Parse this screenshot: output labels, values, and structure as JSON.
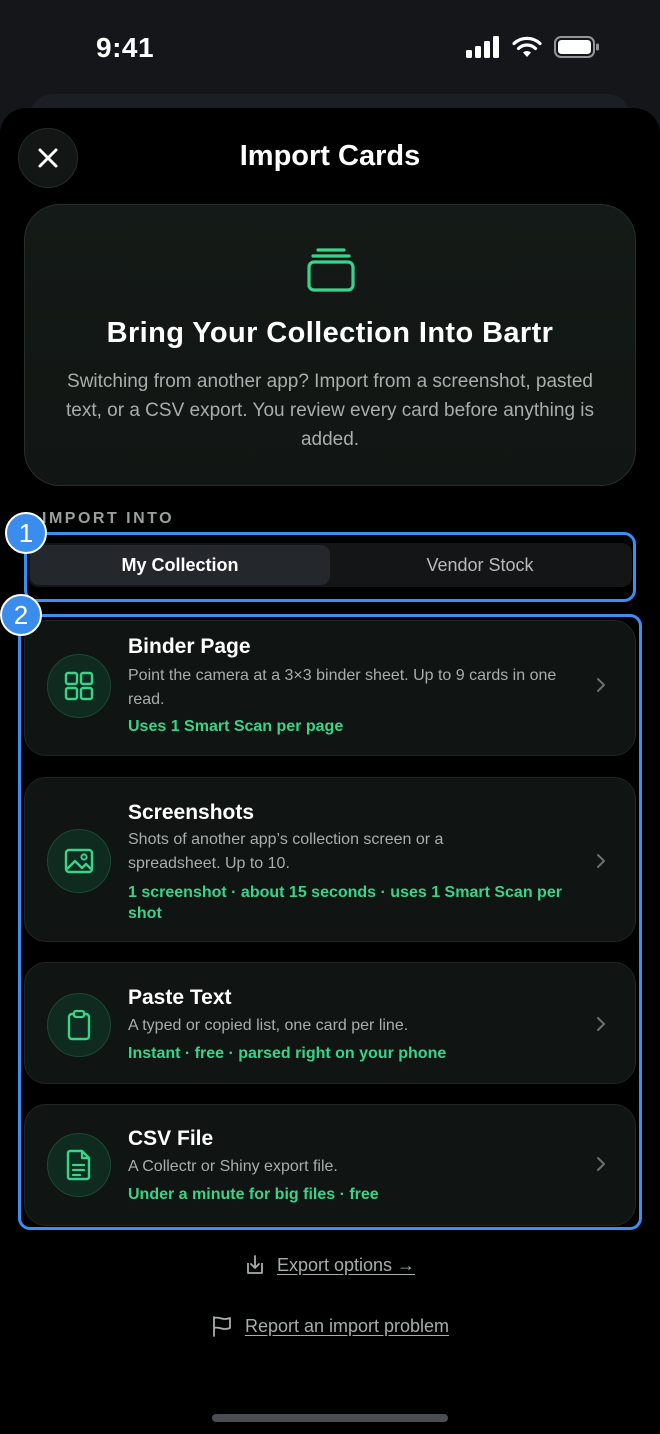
{
  "status_bar": {
    "time": "9:41"
  },
  "header": {
    "title": "Import Cards",
    "close_icon": "close-icon"
  },
  "hero": {
    "icon": "stacked-cards-icon",
    "title": "Bring Your Collection Into Bartr",
    "description": "Switching from another app? Import from a screenshot, pasted text, or a CSV export. You review every card before anything is added."
  },
  "import_into": {
    "label": "IMPORT INTO",
    "options": [
      "My Collection",
      "Vendor Stock"
    ],
    "selected": "My Collection"
  },
  "methods": [
    {
      "icon": "grid-icon",
      "title": "Binder Page",
      "description": "Point the camera at a 3×3 binder sheet. Up to 9 cards in one read.",
      "meta": "Uses 1 Smart Scan per page"
    },
    {
      "icon": "image-icon",
      "title": "Screenshots",
      "description": "Shots of another app’s collection screen or a spreadsheet. Up to 10.",
      "meta": "1 screenshot · about 15 seconds · uses 1 Smart Scan per shot"
    },
    {
      "icon": "clipboard-icon",
      "title": "Paste Text",
      "description": "A typed or copied list, one card per line.",
      "meta": "Instant · free · parsed right on your phone"
    },
    {
      "icon": "file-icon",
      "title": "CSV File",
      "description": "A Collectr or Shiny export file.",
      "meta": "Under a minute for big files · free"
    }
  ],
  "footer": {
    "export_link": "Export options →",
    "report_link": "Report an import problem"
  },
  "annotations": [
    "1",
    "2"
  ],
  "colors": {
    "accent": "#38d48a",
    "annotation": "#3d8ef0",
    "background": "#000000"
  }
}
